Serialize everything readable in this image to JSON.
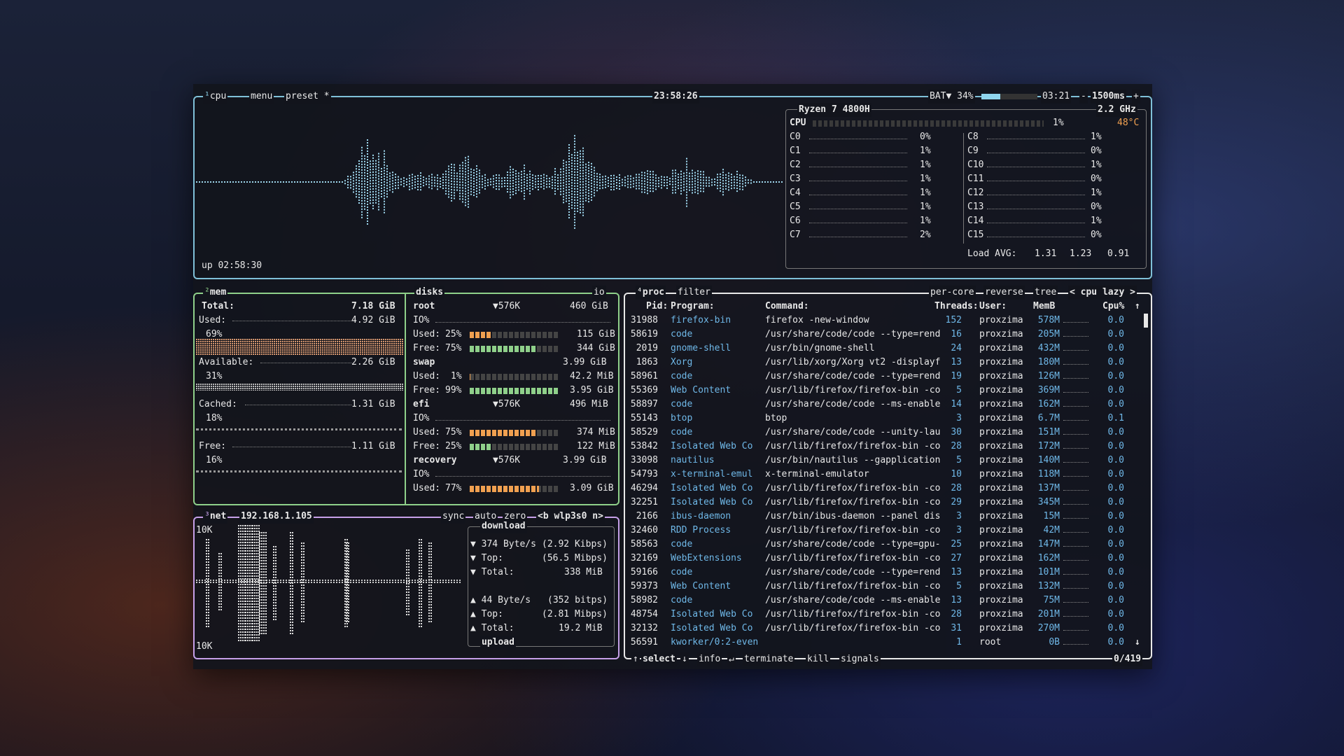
{
  "colors": {
    "cpu": "#7fc0d8",
    "mem": "#8fd08a",
    "net": "#c6a0e8",
    "proc": "#e8e8e8",
    "accent": "#6fb8e8",
    "temp": "#f0a050"
  },
  "cpu": {
    "label": "cpu",
    "menu": "menu",
    "preset": "preset *",
    "clock": "23:58:26",
    "battery": "BAT▼ 34%",
    "battery_level": 0.34,
    "battery_time": "03:21",
    "interval": "1500ms",
    "interval_minus": "-",
    "interval_plus": "+",
    "uptime": "up 02:58:30",
    "model": "Ryzen 7 4800H",
    "freq": "2.2 GHz",
    "total_label": "CPU",
    "total_pct": "1%",
    "temp": "48°C",
    "cores_left": [
      {
        "name": "C0",
        "pct": "0%"
      },
      {
        "name": "C1",
        "pct": "1%"
      },
      {
        "name": "C2",
        "pct": "1%"
      },
      {
        "name": "C3",
        "pct": "1%"
      },
      {
        "name": "C4",
        "pct": "1%"
      },
      {
        "name": "C5",
        "pct": "1%"
      },
      {
        "name": "C6",
        "pct": "1%"
      },
      {
        "name": "C7",
        "pct": "2%"
      }
    ],
    "cores_right": [
      {
        "name": "C8",
        "pct": "1%"
      },
      {
        "name": "C9",
        "pct": "0%"
      },
      {
        "name": "C10",
        "pct": "1%"
      },
      {
        "name": "C11",
        "pct": "0%"
      },
      {
        "name": "C12",
        "pct": "1%"
      },
      {
        "name": "C13",
        "pct": "0%"
      },
      {
        "name": "C14",
        "pct": "1%"
      },
      {
        "name": "C15",
        "pct": "0%"
      }
    ],
    "load_label": "Load AVG:",
    "load": [
      "1.31",
      "1.23",
      "0.91"
    ]
  },
  "mem": {
    "label": "mem",
    "total_label": "Total:",
    "total": "7.18 GiB",
    "used_label": "Used:",
    "used": "4.92 GiB",
    "used_pct": "69%",
    "avail_label": "Available:",
    "avail": "2.26 GiB",
    "avail_pct": "31%",
    "cached_label": "Cached:",
    "cached": "1.31 GiB",
    "cached_pct": "18%",
    "free_label": "Free:",
    "free": "1.11 GiB",
    "free_pct": "16%"
  },
  "disks": {
    "label": "disks",
    "io_tab": "io",
    "io_label": "IO%",
    "used_label": "Used:",
    "free_label": "Free:",
    "root": {
      "name": "root",
      "io": "▼576K",
      "size": "460 GiB",
      "used_pct": "25%",
      "used": "115 GiB",
      "free_pct": "75%",
      "free": "344 GiB",
      "used_frac": 0.25,
      "free_frac": 0.75
    },
    "swap": {
      "name": "swap",
      "size": "3.99 GiB",
      "used_pct": "1%",
      "used": "42.2 MiB",
      "free_pct": "99%",
      "free": "3.95 GiB",
      "used_frac": 0.01,
      "free_frac": 0.99
    },
    "efi": {
      "name": "efi",
      "io": "▼576K",
      "size": "496 MiB",
      "used_pct": "75%",
      "used": "374 MiB",
      "free_pct": "25%",
      "free": "122 MiB",
      "used_frac": 0.75,
      "free_frac": 0.25
    },
    "recovery": {
      "name": "recovery",
      "io": "▼576K",
      "size": "3.99 GiB",
      "used_pct": "77%",
      "used": "3.09 GiB",
      "used_frac": 0.77
    }
  },
  "net": {
    "label": "net",
    "ip": "192.168.1.105",
    "sync": "sync",
    "auto": "auto",
    "zero": "zero",
    "iface": "<b wlp3s0 n>",
    "scale_top": "10K",
    "scale_bottom": "10K",
    "download_label": "download",
    "upload_label": "upload",
    "dl_rate": "374 Byte/s",
    "dl_bits": "(2.92 Kibps)",
    "dl_top_label": "Top:",
    "dl_top": "(56.5 Mibps)",
    "dl_total_label": "Total:",
    "dl_total": "338 MiB",
    "ul_rate": "44 Byte/s",
    "ul_bits": "(352 bitps)",
    "ul_top_label": "Top:",
    "ul_top": "(2.81 Mibps)",
    "ul_total_label": "Total:",
    "ul_total": "19.2 MiB"
  },
  "proc": {
    "label": "proc",
    "filter": "filter",
    "per_core": "per-core",
    "reverse": "reverse",
    "tree": "tree",
    "sort": "< cpu lazy >",
    "headers": {
      "pid": "Pid:",
      "program": "Program:",
      "command": "Command:",
      "threads": "Threads:",
      "user": "User:",
      "mem": "MemB",
      "cpu": "Cpu%"
    },
    "rows": [
      {
        "pid": "31988",
        "program": "firefox-bin",
        "command": "firefox -new-window",
        "threads": "152",
        "user": "proxzima",
        "mem": "578M",
        "cpu": "0.0"
      },
      {
        "pid": "58619",
        "program": "code",
        "command": "/usr/share/code/code --type=rend",
        "threads": "16",
        "user": "proxzima",
        "mem": "205M",
        "cpu": "0.0"
      },
      {
        "pid": "2019",
        "program": "gnome-shell",
        "command": "/usr/bin/gnome-shell",
        "threads": "24",
        "user": "proxzima",
        "mem": "432M",
        "cpu": "0.0"
      },
      {
        "pid": "1863",
        "program": "Xorg",
        "command": "/usr/lib/xorg/Xorg vt2 -displayf",
        "threads": "13",
        "user": "proxzima",
        "mem": "180M",
        "cpu": "0.0"
      },
      {
        "pid": "58961",
        "program": "code",
        "command": "/usr/share/code/code --type=rend",
        "threads": "19",
        "user": "proxzima",
        "mem": "126M",
        "cpu": "0.0"
      },
      {
        "pid": "55369",
        "program": "Web Content",
        "command": "/usr/lib/firefox/firefox-bin -co",
        "threads": "5",
        "user": "proxzima",
        "mem": "369M",
        "cpu": "0.0"
      },
      {
        "pid": "58897",
        "program": "code",
        "command": "/usr/share/code/code --ms-enable",
        "threads": "14",
        "user": "proxzima",
        "mem": "162M",
        "cpu": "0.0"
      },
      {
        "pid": "55143",
        "program": "btop",
        "command": "btop",
        "threads": "3",
        "user": "proxzima",
        "mem": "6.7M",
        "cpu": "0.1"
      },
      {
        "pid": "58529",
        "program": "code",
        "command": "/usr/share/code/code --unity-lau",
        "threads": "30",
        "user": "proxzima",
        "mem": "151M",
        "cpu": "0.0"
      },
      {
        "pid": "53842",
        "program": "Isolated Web Co",
        "command": "/usr/lib/firefox/firefox-bin -co",
        "threads": "28",
        "user": "proxzima",
        "mem": "172M",
        "cpu": "0.0"
      },
      {
        "pid": "33098",
        "program": "nautilus",
        "command": "/usr/bin/nautilus --gapplication",
        "threads": "5",
        "user": "proxzima",
        "mem": "140M",
        "cpu": "0.0"
      },
      {
        "pid": "54793",
        "program": "x-terminal-emul",
        "command": "x-terminal-emulator",
        "threads": "10",
        "user": "proxzima",
        "mem": "118M",
        "cpu": "0.0"
      },
      {
        "pid": "46294",
        "program": "Isolated Web Co",
        "command": "/usr/lib/firefox/firefox-bin -co",
        "threads": "28",
        "user": "proxzima",
        "mem": "137M",
        "cpu": "0.0"
      },
      {
        "pid": "32251",
        "program": "Isolated Web Co",
        "command": "/usr/lib/firefox/firefox-bin -co",
        "threads": "29",
        "user": "proxzima",
        "mem": "345M",
        "cpu": "0.0"
      },
      {
        "pid": "2166",
        "program": "ibus-daemon",
        "command": "/usr/bin/ibus-daemon --panel dis",
        "threads": "3",
        "user": "proxzima",
        "mem": "15M",
        "cpu": "0.0"
      },
      {
        "pid": "32460",
        "program": "RDD Process",
        "command": "/usr/lib/firefox/firefox-bin -co",
        "threads": "3",
        "user": "proxzima",
        "mem": "42M",
        "cpu": "0.0"
      },
      {
        "pid": "58563",
        "program": "code",
        "command": "/usr/share/code/code --type=gpu-",
        "threads": "25",
        "user": "proxzima",
        "mem": "147M",
        "cpu": "0.0"
      },
      {
        "pid": "32169",
        "program": "WebExtensions",
        "command": "/usr/lib/firefox/firefox-bin -co",
        "threads": "27",
        "user": "proxzima",
        "mem": "162M",
        "cpu": "0.0"
      },
      {
        "pid": "59166",
        "program": "code",
        "command": "/usr/share/code/code --type=rend",
        "threads": "13",
        "user": "proxzima",
        "mem": "101M",
        "cpu": "0.0"
      },
      {
        "pid": "59373",
        "program": "Web Content",
        "command": "/usr/lib/firefox/firefox-bin -co",
        "threads": "5",
        "user": "proxzima",
        "mem": "132M",
        "cpu": "0.0"
      },
      {
        "pid": "58982",
        "program": "code",
        "command": "/usr/share/code/code --ms-enable",
        "threads": "13",
        "user": "proxzima",
        "mem": "75M",
        "cpu": "0.0"
      },
      {
        "pid": "48754",
        "program": "Isolated Web Co",
        "command": "/usr/lib/firefox/firefox-bin -co",
        "threads": "28",
        "user": "proxzima",
        "mem": "201M",
        "cpu": "0.0"
      },
      {
        "pid": "32132",
        "program": "Isolated Web Co",
        "command": "/usr/lib/firefox/firefox-bin -co",
        "threads": "31",
        "user": "proxzima",
        "mem": "270M",
        "cpu": "0.0"
      },
      {
        "pid": "56591",
        "program": "kworker/0:2-even",
        "command": "",
        "threads": "1",
        "user": "root",
        "mem": "0B",
        "cpu": "0.0"
      }
    ],
    "footer": {
      "select": "select",
      "info": "info",
      "terminate": "terminate",
      "kill": "kill",
      "signals": "signals",
      "count": "0/419",
      "up_arrow": "↑",
      "down_arrow": "↓",
      "enter": "↵"
    }
  }
}
